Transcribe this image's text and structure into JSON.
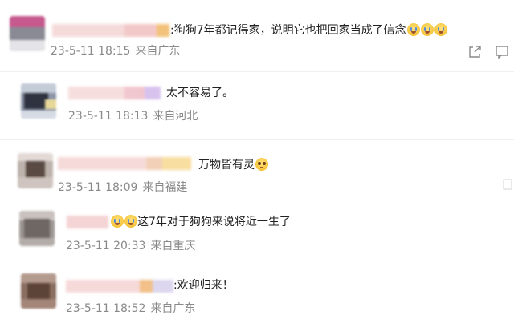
{
  "comments": [
    {
      "text": ":狗狗7年都记得家，说明它也把回家当成了信念",
      "emoji_count": 3,
      "emoji_type": "crying-face",
      "date": "23-5-11 18:15",
      "location": "来自广东",
      "actions": [
        "share-icon",
        "comment-icon"
      ]
    },
    {
      "text": "太不容易了。",
      "date": "23-5-11 18:13",
      "location": "来自河北"
    },
    {
      "text": "万物皆有灵",
      "emoji_type": "pleading-face",
      "date": "23-5-11 18:09",
      "location": "来自福建"
    },
    {
      "text": "这7年对于狗狗来说将近一生了",
      "emoji_type": "crying-face",
      "emoji_count": 2,
      "date": "23-5-11 20:33",
      "location": "来自重庆"
    },
    {
      "text": ":欢迎归来！",
      "date": "23-5-11 18:52",
      "location": "来自广东"
    }
  ],
  "colors": {
    "text": "#222222",
    "meta": "#8a8a8a",
    "background": "#ffffff"
  }
}
